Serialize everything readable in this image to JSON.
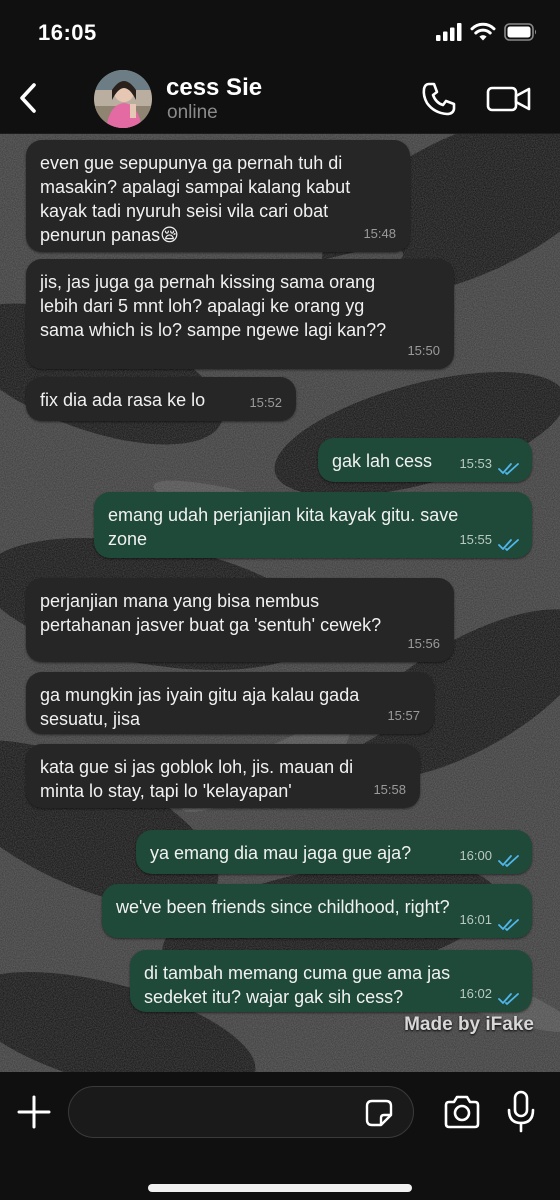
{
  "status_bar": {
    "time": "16:05"
  },
  "header": {
    "contact_name": "cess Sie",
    "status": "online"
  },
  "messages": [
    {
      "direction": "in",
      "text": "even gue sepupunya ga pernah tuh di\nmasakin? apalagi sampai kalang kabut\nkayak tadi nyuruh seisi vila cari obat\npenurun panas😪",
      "time": "15:48"
    },
    {
      "direction": "in",
      "text": "jis, jas juga ga pernah kissing sama orang\nlebih dari 5 mnt loh? apalagi ke orang yg\nsama which is lo? sampe ngewe lagi kan??",
      "time": "15:50"
    },
    {
      "direction": "in",
      "text": "fix dia ada rasa ke lo",
      "time": "15:52"
    },
    {
      "direction": "out",
      "text": "gak lah cess",
      "time": "15:53",
      "read": true
    },
    {
      "direction": "out",
      "text": "emang udah perjanjian kita kayak gitu. save\nzone",
      "time": "15:55",
      "read": true
    },
    {
      "direction": "in",
      "text": "perjanjian mana yang bisa nembus\npertahanan jasver buat ga 'sentuh' cewek?",
      "time": "15:56"
    },
    {
      "direction": "in",
      "text": "ga mungkin jas iyain gitu aja kalau gada\nsesuatu, jisa",
      "time": "15:57"
    },
    {
      "direction": "in",
      "text": "kata gue si jas goblok loh, jis. mauan di\nminta lo stay, tapi lo 'kelayapan'",
      "time": "15:58"
    },
    {
      "direction": "out",
      "text": "ya emang dia mau jaga gue aja?",
      "time": "16:00",
      "read": true
    },
    {
      "direction": "out",
      "text": "we've been friends since childhood, right?",
      "time": "16:01",
      "read": true
    },
    {
      "direction": "out",
      "text": "di tambah memang cuma gue ama jas\nsedeket itu? wajar gak sih cess?",
      "time": "16:02",
      "read": true
    }
  ],
  "watermark": "Made by iFake",
  "input": {
    "value": "",
    "placeholder": ""
  },
  "colors": {
    "incoming_bubble": "#262626",
    "outgoing_bubble": "#1f4a3a",
    "read_ticks": "#4fb6ec",
    "background": "#101010"
  },
  "icons": [
    "back-chevron-icon",
    "phone-icon",
    "video-camera-icon",
    "plus-icon",
    "sticker-icon",
    "camera-icon",
    "microphone-icon",
    "signal-icon",
    "wifi-icon",
    "battery-icon"
  ]
}
